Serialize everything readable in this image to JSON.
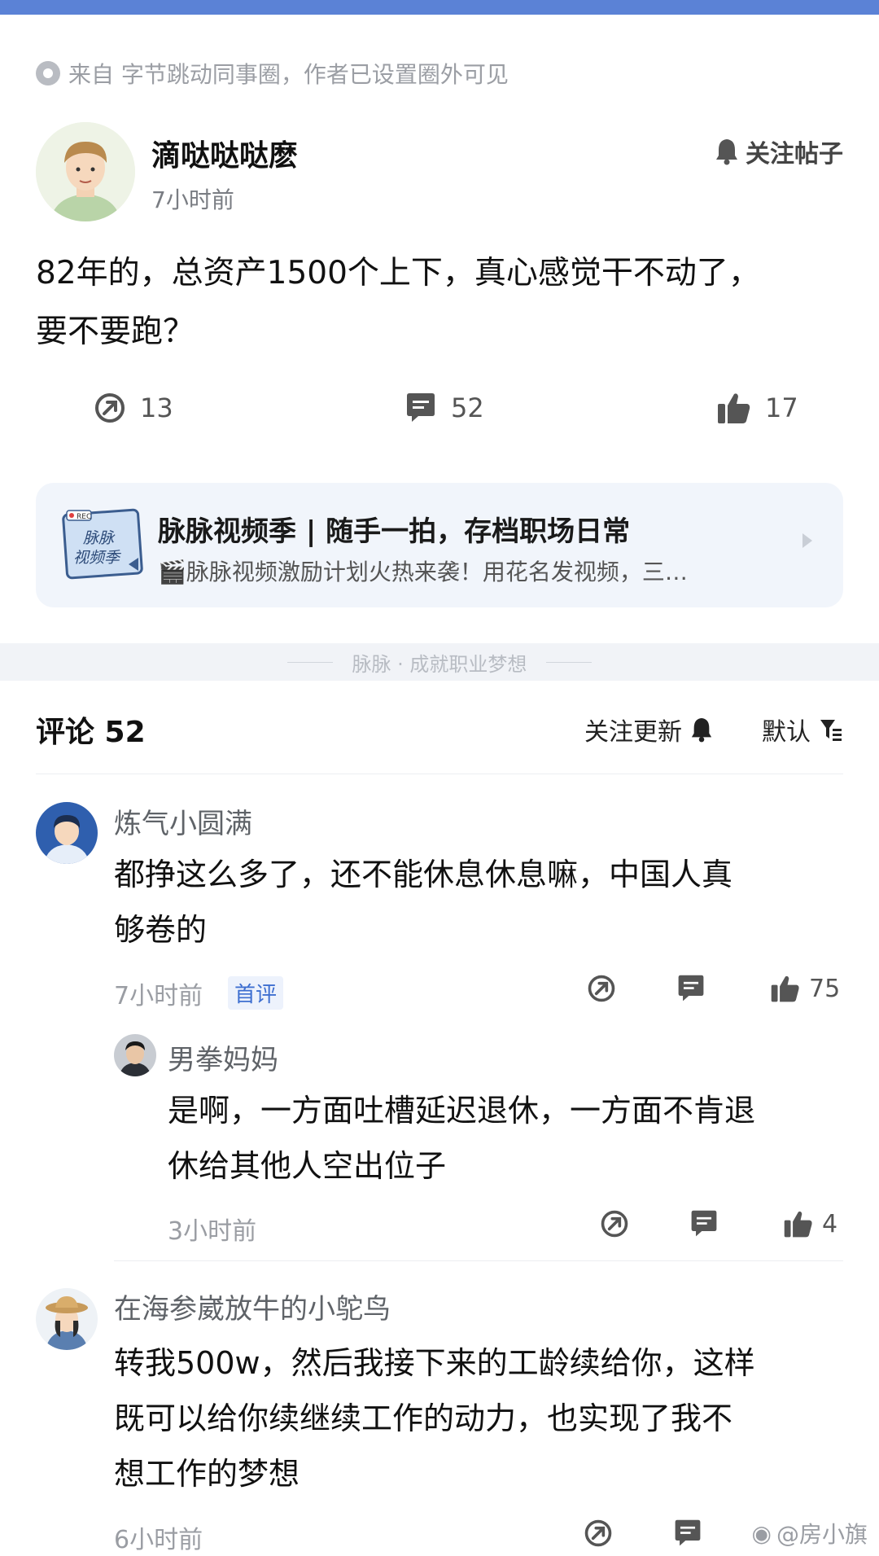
{
  "source": {
    "text": "来自 字节跳动同事圈，作者已设置圈外可见"
  },
  "post": {
    "author_name": "滴哒哒哒麽",
    "time": "7小时前",
    "follow_label": "关注帖子",
    "text_line1": "82年的，总资产1500个上下，真心感觉干不动了，",
    "text_line2": "要不要跑？",
    "actions": {
      "share_count": "13",
      "comment_count": "52",
      "like_count": "17"
    }
  },
  "banner": {
    "thumb_text_line1": "脉脉",
    "thumb_text_line2": "视频季",
    "thumb_tag": "REC",
    "title": "脉脉视频季 | 随手一拍，存档职场日常",
    "subtitle": "🎬脉脉视频激励计划火热来袭！用花名发视频，三…"
  },
  "divider": {
    "text": "脉脉 · 成就职业梦想"
  },
  "comments_header": {
    "title": "评论 52",
    "follow_updates": "关注更新",
    "sort": "默认"
  },
  "comments": [
    {
      "name": "炼气小圆满",
      "text_line1": "都挣这么多了，还不能休息休息嘛，中国人真",
      "text_line2": "够卷的",
      "time": "7小时前",
      "tag": "首评",
      "likes": "75"
    },
    {
      "name": "男拳妈妈",
      "text_line1": "是啊，一方面吐槽延迟退休，一方面不肯退",
      "text_line2": "休给其他人空出位子",
      "time": "3小时前",
      "likes": "4"
    },
    {
      "name": "在海参崴放牛的小鸵鸟",
      "text_line1": "转我500w，然后我接下来的工龄续给你，这样",
      "text_line2": "既可以给你续继续工作的动力，也实现了我不",
      "text_line3": "想工作的梦想",
      "time": "6小时前"
    }
  ],
  "watermark": {
    "text": "@房小旗"
  },
  "colors": {
    "accent": "#3e6fd0",
    "topbar": "#5b82d6",
    "muted": "#9a9da3"
  }
}
